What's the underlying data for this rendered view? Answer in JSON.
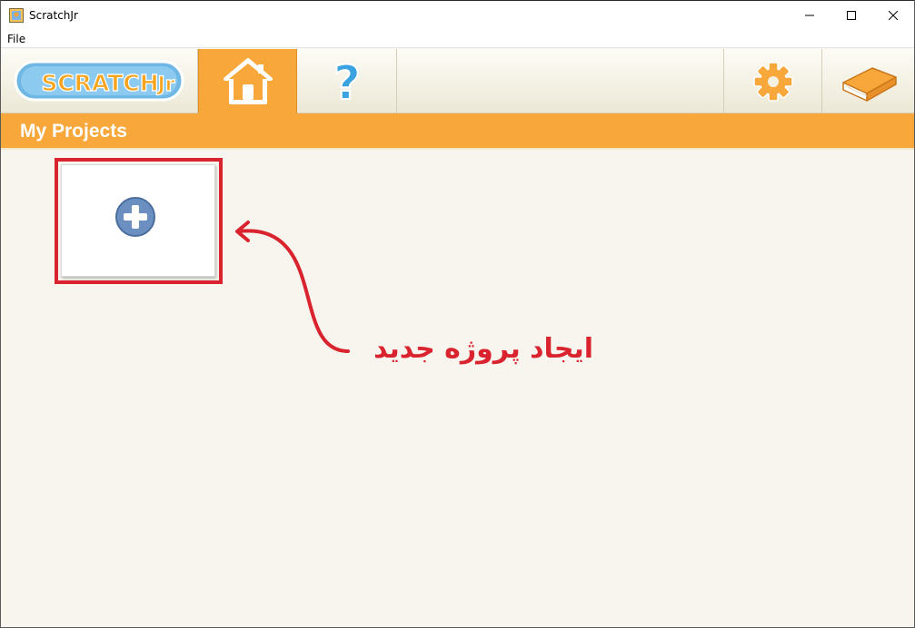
{
  "window": {
    "title": "ScratchJr",
    "controls": {
      "minimize": "minimize",
      "maximize": "maximize",
      "close": "close"
    }
  },
  "menubar": {
    "items": [
      {
        "label": "File"
      }
    ]
  },
  "toolbar": {
    "logo": {
      "icon": "scratchjr-logo-icon",
      "label": "ScratchJr"
    },
    "tabs": [
      {
        "icon": "home-icon",
        "selected": true
      },
      {
        "icon": "help-question-icon",
        "selected": false
      }
    ],
    "right_buttons": [
      {
        "icon": "gear-icon"
      },
      {
        "icon": "book-icon"
      }
    ],
    "colors": {
      "accent": "#f8a73a",
      "toolbar_bg": "#f4f1e3"
    }
  },
  "header": {
    "title": "My Projects"
  },
  "projects": {
    "new_project": {
      "icon": "plus-circle-icon"
    }
  },
  "annotation": {
    "text": "ایجاد پروژه جدید",
    "color": "#d9232e"
  }
}
